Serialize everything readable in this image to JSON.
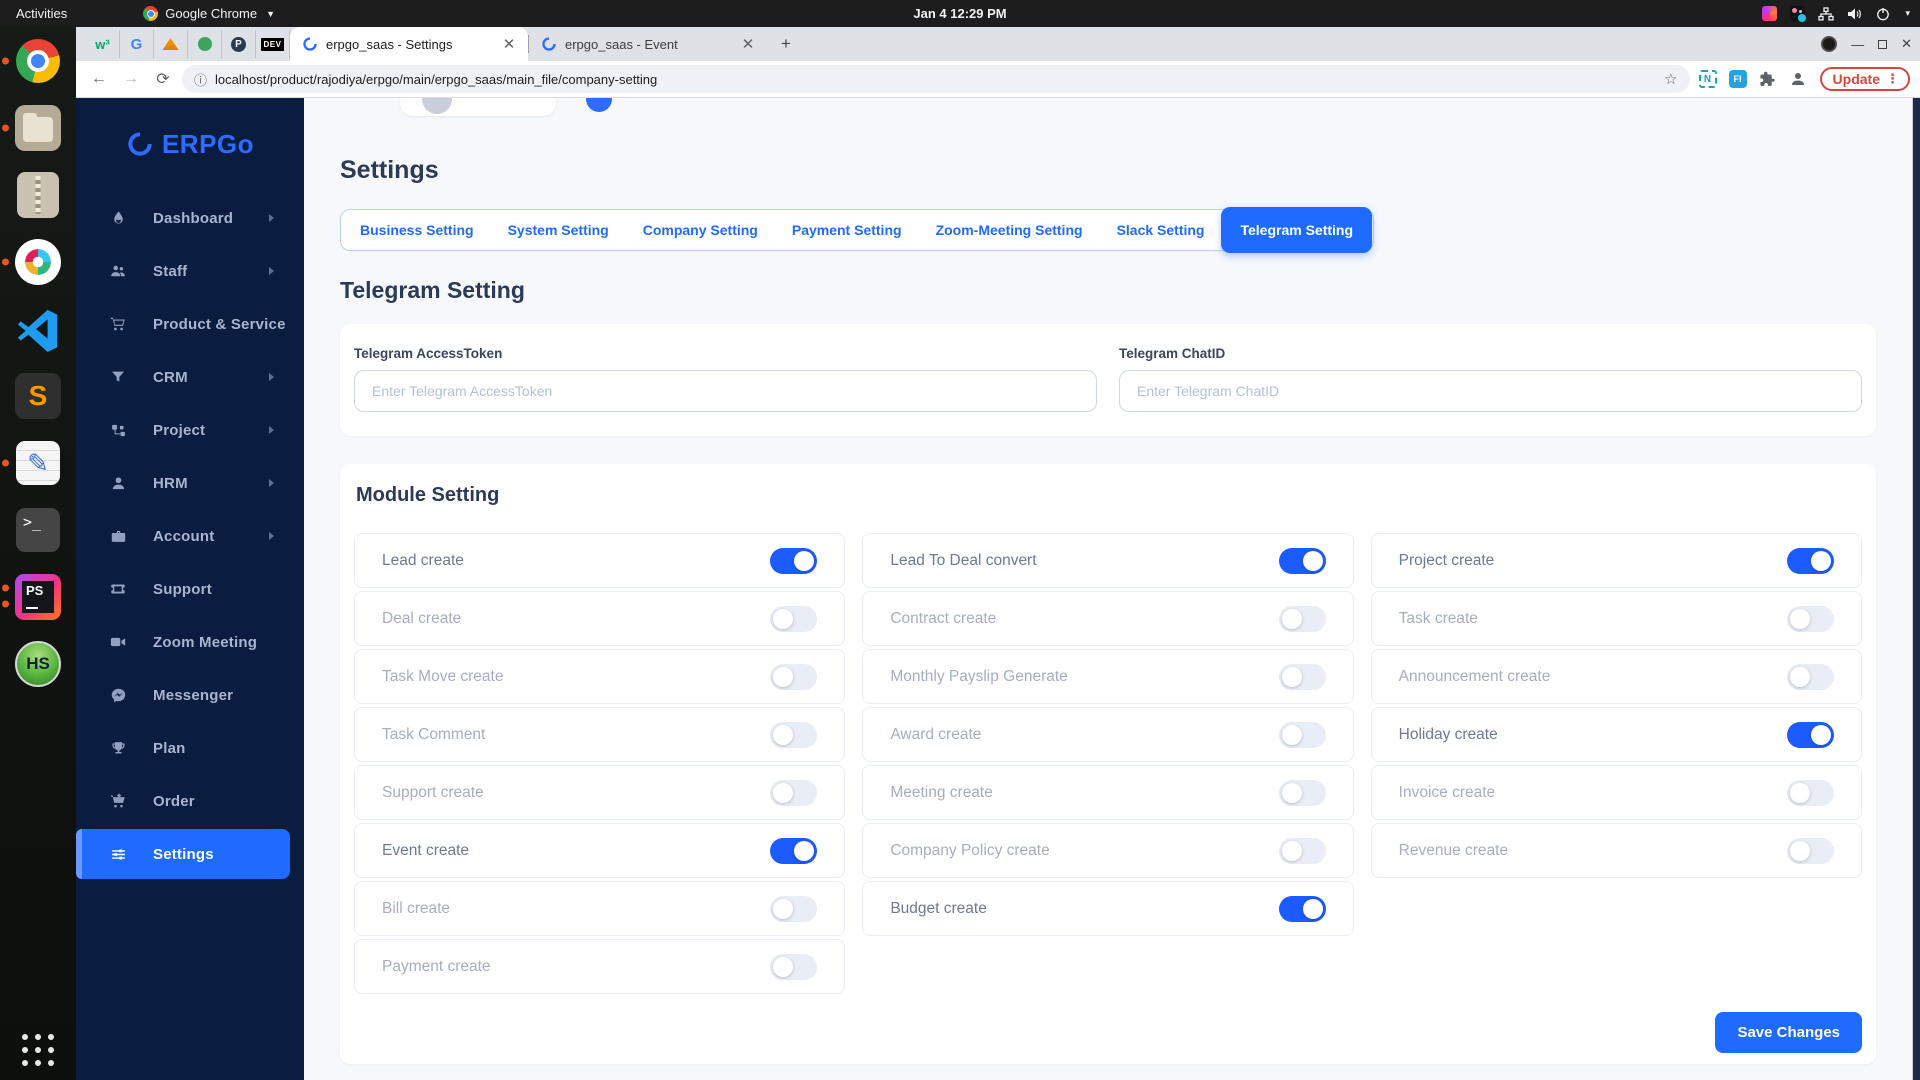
{
  "desktop": {
    "topbar": {
      "activities": "Activities",
      "app_name": "Google Chrome",
      "clock": "Jan 4 12:29 PM"
    }
  },
  "browser": {
    "pinned_tabs": [
      {
        "name": "w3schools",
        "glyph": "w³"
      },
      {
        "name": "google",
        "glyph": "G"
      },
      {
        "name": "phpmyadmin",
        "glyph": ""
      },
      {
        "name": "green-app",
        "glyph": ""
      },
      {
        "name": "p-app",
        "glyph": "P"
      },
      {
        "name": "devto",
        "glyph": "DEV"
      }
    ],
    "tabs": [
      {
        "title": "erpgo_saas - Settings",
        "active": true
      },
      {
        "title": "erpgo_saas - Event",
        "active": false
      }
    ],
    "address": "localhost/product/rajodiya/erpgo/main/erpgo_saas/main_file/company-setting",
    "extensions": {
      "n_glyph": "N",
      "fi_glyph": "FI"
    },
    "update_label": "Update"
  },
  "dock_glyphs": {
    "sublime": "S",
    "terminal": ">_",
    "phpstorm": "PS",
    "heidisql": "HS",
    "editor": "✎"
  },
  "app": {
    "brand": "ERPGo",
    "sidebar": [
      {
        "label": "Dashboard",
        "arrow": true,
        "active": false
      },
      {
        "label": "Staff",
        "arrow": true,
        "active": false
      },
      {
        "label": "Product & Service",
        "arrow": false,
        "active": false
      },
      {
        "label": "CRM",
        "arrow": true,
        "active": false
      },
      {
        "label": "Project",
        "arrow": true,
        "active": false
      },
      {
        "label": "HRM",
        "arrow": true,
        "active": false
      },
      {
        "label": "Account",
        "arrow": true,
        "active": false
      },
      {
        "label": "Support",
        "arrow": false,
        "active": false
      },
      {
        "label": "Zoom Meeting",
        "arrow": false,
        "active": false
      },
      {
        "label": "Messenger",
        "arrow": false,
        "active": false
      },
      {
        "label": "Plan",
        "arrow": false,
        "active": false
      },
      {
        "label": "Order",
        "arrow": false,
        "active": false
      },
      {
        "label": "Settings",
        "arrow": false,
        "active": true
      }
    ],
    "page_title": "Settings",
    "tabs": [
      {
        "label": "Business Setting",
        "active": false
      },
      {
        "label": "System Setting",
        "active": false
      },
      {
        "label": "Company Setting",
        "active": false
      },
      {
        "label": "Payment Setting",
        "active": false
      },
      {
        "label": "Zoom-Meeting Setting",
        "active": false
      },
      {
        "label": "Slack Setting",
        "active": false
      },
      {
        "label": "Telegram Setting",
        "active": true
      }
    ],
    "section_title": "Telegram Setting",
    "fields": [
      {
        "label": "Telegram AccessToken",
        "placeholder": "Enter Telegram AccessToken",
        "value": ""
      },
      {
        "label": "Telegram ChatID",
        "placeholder": "Enter Telegram ChatID",
        "value": ""
      }
    ],
    "module_title": "Module Setting",
    "modules": [
      {
        "items": [
          {
            "label": "Lead create",
            "on": true
          },
          {
            "label": "Deal create",
            "on": false
          },
          {
            "label": "Task Move create",
            "on": false
          },
          {
            "label": "Task Comment",
            "on": false
          },
          {
            "label": "Support create",
            "on": false
          },
          {
            "label": "Event create",
            "on": true
          },
          {
            "label": "Bill create",
            "on": false
          },
          {
            "label": "Payment create",
            "on": false
          }
        ]
      },
      {
        "items": [
          {
            "label": "Lead To Deal convert",
            "on": true
          },
          {
            "label": "Contract create",
            "on": false
          },
          {
            "label": "Monthly Payslip Generate",
            "on": false
          },
          {
            "label": "Award create",
            "on": false
          },
          {
            "label": "Meeting create",
            "on": false
          },
          {
            "label": "Company Policy create",
            "on": false
          },
          {
            "label": "Budget create",
            "on": true
          }
        ]
      },
      {
        "items": [
          {
            "label": "Project create",
            "on": true
          },
          {
            "label": "Task create",
            "on": false
          },
          {
            "label": "Announcement create",
            "on": false
          },
          {
            "label": "Holiday create",
            "on": true
          },
          {
            "label": "Invoice create",
            "on": false
          },
          {
            "label": "Revenue create",
            "on": false
          }
        ]
      }
    ],
    "save_label": "Save Changes"
  },
  "colors": {
    "accent": "#1f6bff",
    "sidebar": "#0a1c3f",
    "toggle_off": "#e9edf5",
    "update_red": "#d4473d"
  }
}
